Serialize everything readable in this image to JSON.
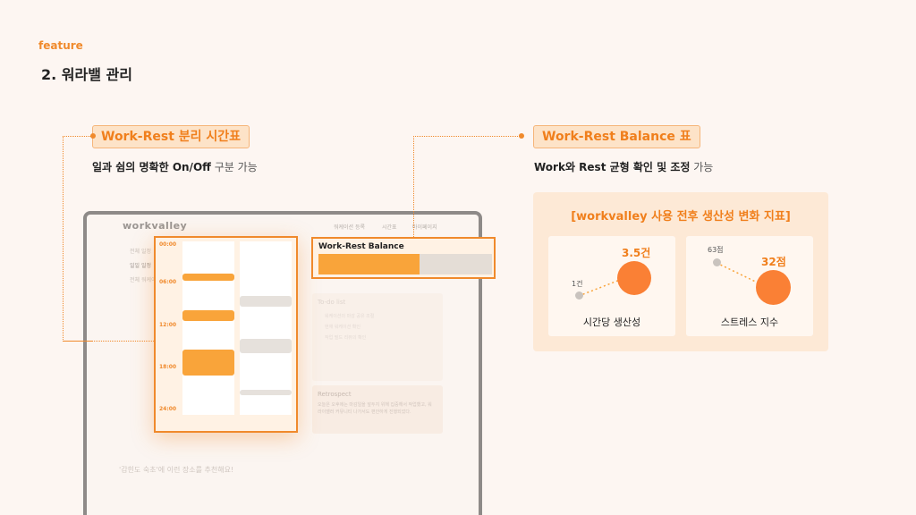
{
  "header": {
    "feature_label": "feature",
    "title": "2. 워라밸 관리"
  },
  "left_feature": {
    "tag": "Work-Rest 분리 시간표",
    "subtitle_strong": "일과 쉼의 명확한 On/Off",
    "subtitle_light": " 구분 가능"
  },
  "right_feature": {
    "tag": "Work-Rest Balance 표",
    "subtitle_strong": "Work와 Rest 균형 확인 및 조정",
    "subtitle_light": " 가능"
  },
  "device": {
    "logo": "workvalley",
    "nav": [
      "워케이션 등록",
      "시간표",
      "마이페이지"
    ],
    "side_items": [
      "전체 일정",
      "일일 일정",
      "전체 워케이션"
    ],
    "timetable": {
      "times": [
        "00:00",
        "06:00",
        "12:00",
        "18:00",
        "24:00"
      ],
      "work_blocks_hours": [
        [
          4.5,
          5.5
        ],
        [
          9.5,
          11.0
        ],
        [
          15.0,
          18.5
        ]
      ],
      "rest_blocks_hours": [
        [
          7.5,
          9.0
        ],
        [
          13.5,
          15.5
        ],
        [
          20.5,
          21.3
        ]
      ]
    },
    "balance": {
      "title": "Work-Rest Balance",
      "work_ratio": 0.58
    },
    "todo_title": "To-do list",
    "todo_items": [
      "워케이션의 마감 공유 조절",
      "현재 워케이션 확인",
      "작업 필드 리뷰의 확인"
    ],
    "retro_title": "Retrospect",
    "retro_text": "오늘은 오후에는 마감일을 앞두지 위해 집중해서 작업했고, 워라이밸러 커뮤니티 나가서도 편안하게 진행되었다.",
    "bottom_note": "'감힌도 숙초'에 이런 장소를 추천해요!"
  },
  "panel": {
    "title": "[workvalley 사용 전후 생산성 변화 지표]",
    "cards": [
      {
        "label": "시간당 생산성",
        "before": "1건",
        "after": "3.5건"
      },
      {
        "label": "스트레스 지수",
        "before": "63점",
        "after": "32점"
      }
    ]
  },
  "colors": {
    "accent": "#f08a2c",
    "work": "#f9a43a",
    "rest": "#e6e1dc",
    "bubble": "#fa8035",
    "background": "#fdf6f2",
    "panel": "#fde9d6"
  }
}
